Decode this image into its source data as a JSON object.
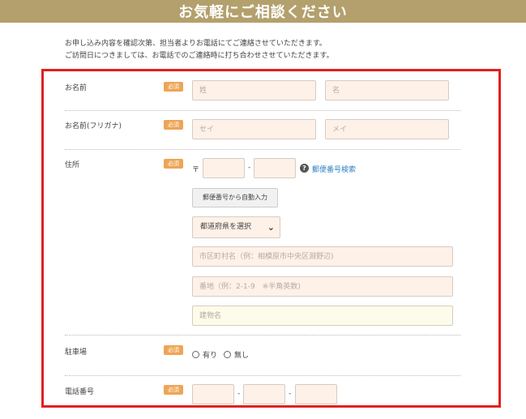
{
  "header": {
    "title": "お気軽にご相談ください"
  },
  "intro": {
    "line1": "お申し込み内容を確認次第、担当者よりお電話にてご連絡させていただきます。",
    "line2": "ご訪問日につきましては、お電話でのご連絡時に打ち合わせさせていただきます。"
  },
  "required_label": "必須",
  "form": {
    "name": {
      "label": "お名前",
      "last_placeholder": "姓",
      "first_placeholder": "名"
    },
    "furigana": {
      "label": "お名前(フリガナ)",
      "last_placeholder": "セイ",
      "first_placeholder": "メイ"
    },
    "address": {
      "label": "住所",
      "postal_mark": "〒",
      "separator": "-",
      "postal_search_link": "郵便番号検索",
      "auto_fill_button": "郵便番号から自動入力",
      "prefecture_select": "都道府県を選択",
      "city_placeholder": "市区町村名（例：相模原市中央区淵野辺)",
      "street_placeholder": "番地（例：2-1-9　※半角英数)",
      "building_placeholder": "建物名"
    },
    "parking": {
      "label": "駐車場",
      "options": [
        "有り",
        "無し"
      ]
    },
    "phone": {
      "label": "電話番号",
      "separator": "-"
    }
  },
  "colors": {
    "header_bg": "#b3a06d",
    "frame": "#e02020",
    "badge": "#eea556",
    "input_bg": "#fef1e8",
    "link": "#2e7fc3"
  }
}
